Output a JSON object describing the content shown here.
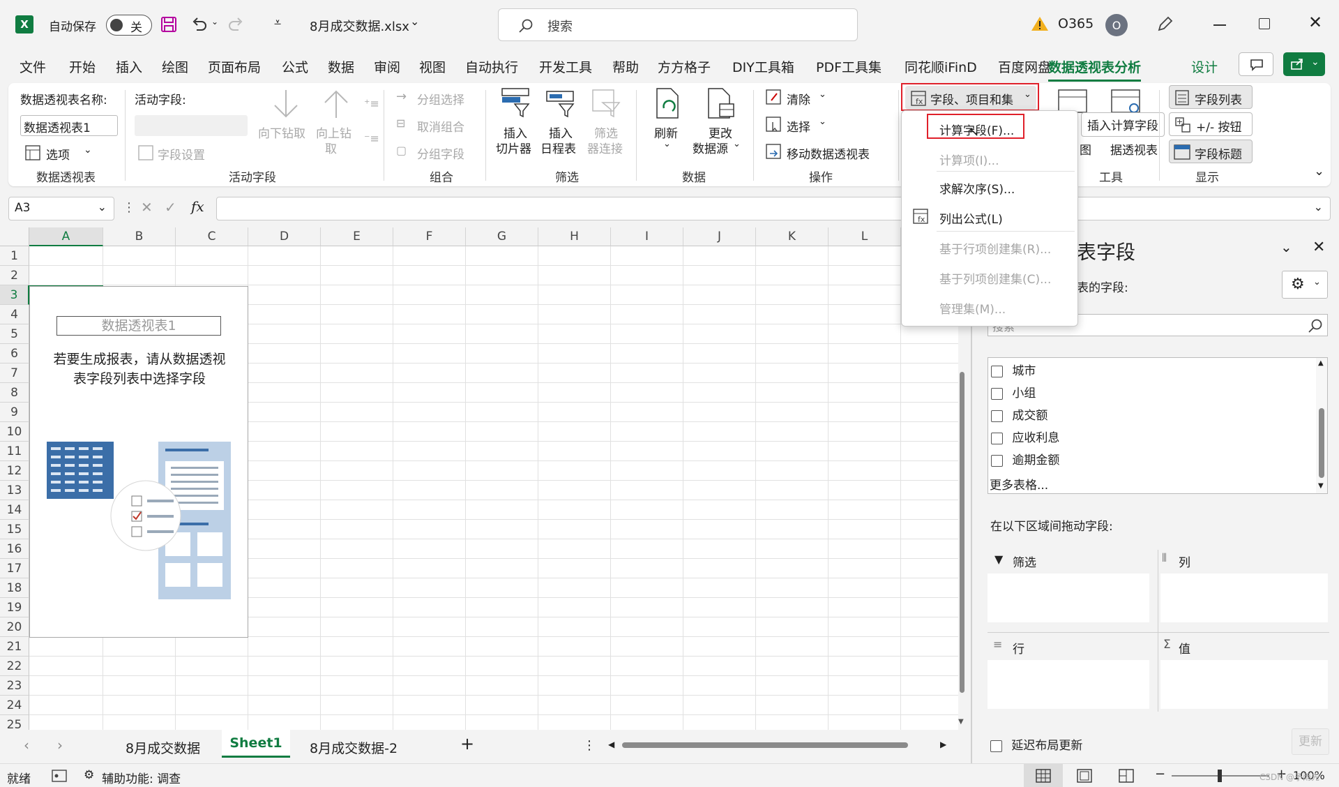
{
  "titlebar": {
    "autosave_label": "自动保存",
    "autosave_state": "关",
    "filename": "8月成交数据.xlsx",
    "search_placeholder": "搜索",
    "account": "O365",
    "avatar_initial": "O"
  },
  "menu": [
    "文件",
    "开始",
    "插入",
    "绘图",
    "页面布局",
    "公式",
    "数据",
    "审阅",
    "视图",
    "自动执行",
    "开发工具",
    "帮助",
    "方方格子",
    "DIY工具箱",
    "PDF工具集",
    "同花顺iFinD",
    "百度网盘",
    "数据透视表分析",
    "设计"
  ],
  "ribbon": {
    "pivot_name_label": "数据透视表名称:",
    "pivot_name_value": "数据透视表1",
    "options": "选项",
    "group_pivot": "数据透视表",
    "active_field_label": "活动字段:",
    "field_settings": "字段设置",
    "drill_down": "向下钻取",
    "drill_up_1": "向上钻",
    "drill_up_2": "取",
    "group_active": "活动字段",
    "group_select": "分组选择",
    "ungroup": "取消组合",
    "group_field": "分组字段",
    "group_group": "组合",
    "insert_slicer_1": "插入",
    "insert_slicer_2": "切片器",
    "insert_timeline_1": "插入",
    "insert_timeline_2": "日程表",
    "filter_conn_1": "筛选",
    "filter_conn_2": "器连接",
    "group_filter": "筛选",
    "refresh": "刷新",
    "change_source_1": "更改",
    "change_source_2": "数据源",
    "group_data": "数据",
    "clear": "清除",
    "select": "选择",
    "move_pivot": "移动数据透视表",
    "group_actions": "操作",
    "fields_items_sets": "字段、项目和集",
    "tooltip": "插入计算字段",
    "pivot_chart": "图",
    "recommended": "据透视表",
    "group_tools": "工具",
    "field_list": "字段列表",
    "plus_minus": "+/- 按钮",
    "field_headers": "字段标题",
    "group_show": "显示"
  },
  "dropdown": {
    "items": [
      {
        "label": "计算字段(F)...",
        "enabled": true
      },
      {
        "label": "计算项(I)...",
        "enabled": false
      },
      {
        "label": "求解次序(S)...",
        "enabled": true
      },
      {
        "label": "列出公式(L)",
        "enabled": true
      },
      {
        "label": "基于行项创建集(R)...",
        "enabled": false
      },
      {
        "label": "基于列项创建集(C)...",
        "enabled": false
      },
      {
        "label": "管理集(M)...",
        "enabled": false
      }
    ]
  },
  "formula": {
    "cell_ref": "A3",
    "fx": "fx"
  },
  "grid": {
    "columns": [
      "A",
      "B",
      "C",
      "D",
      "E",
      "F",
      "G",
      "H",
      "I",
      "J",
      "K",
      "L"
    ],
    "rows": [
      "1",
      "2",
      "3",
      "4",
      "5",
      "6",
      "7",
      "8",
      "9",
      "10",
      "11",
      "12",
      "13",
      "14",
      "15",
      "16",
      "17",
      "18",
      "19",
      "20",
      "21",
      "22",
      "23",
      "24",
      "25"
    ]
  },
  "pivot_placeholder": {
    "title": "数据透视表1",
    "hint_line1": "若要生成报表，请从数据透视",
    "hint_line2": "表字段列表中选择字段"
  },
  "field_panel": {
    "title": "表字段",
    "subtitle": "表的字段:",
    "search_placeholder": "搜索",
    "fields": [
      "城市",
      "小组",
      "成交额",
      "应收利息",
      "逾期金额"
    ],
    "more_tables": "更多表格...",
    "drag_label": "在以下区域间拖动字段:",
    "area_filter": "筛选",
    "area_columns": "列",
    "area_rows": "行",
    "area_values": "值",
    "defer_update": "延迟布局更新",
    "update_button": "更新"
  },
  "sheets": {
    "tabs": [
      "8月成交数据",
      "Sheet1",
      "8月成交数据-2"
    ],
    "active": "Sheet1",
    "add": "+"
  },
  "status": {
    "ready": "就绪",
    "accessibility": "辅助功能: 调查",
    "zoom": "100%",
    "watermark": "CSDN @予雨先"
  }
}
